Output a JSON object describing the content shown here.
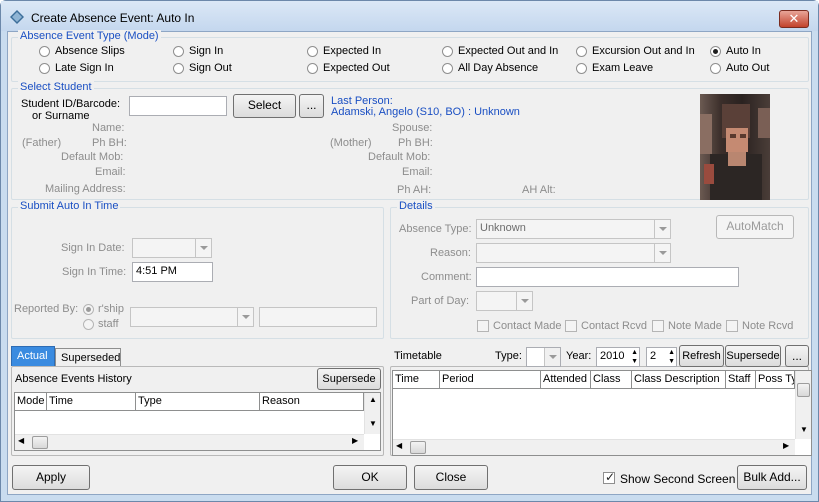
{
  "window": {
    "title": "Create Absence Event: Auto In"
  },
  "event_type": {
    "title": "Absence Event Type (Mode)",
    "options": [
      {
        "label": "Absence Slips",
        "checked": false
      },
      {
        "label": "Sign In",
        "checked": false
      },
      {
        "label": "Expected In",
        "checked": false
      },
      {
        "label": "Expected Out and In",
        "checked": false
      },
      {
        "label": "Excursion Out and In",
        "checked": false
      },
      {
        "label": "Auto In",
        "checked": true
      },
      {
        "label": "Late Sign In",
        "checked": false
      },
      {
        "label": "Sign Out",
        "checked": false
      },
      {
        "label": "Expected Out",
        "checked": false
      },
      {
        "label": "All Day Absence",
        "checked": false
      },
      {
        "label": "Exam Leave",
        "checked": false
      },
      {
        "label": "Auto Out",
        "checked": false
      }
    ]
  },
  "student": {
    "title": "Select Student",
    "id_label_1": "Student ID/Barcode:",
    "id_label_2": "or Surname",
    "id_value": "",
    "select_button": "Select",
    "more_button": "...",
    "last_person_label": "Last Person:",
    "last_person_value": "Adamski, Angelo (S10, BO) : Unknown",
    "name_label": "Name:",
    "father_label": "(Father)",
    "ph_bh_label": "Ph BH:",
    "default_mob_label": "Default Mob:",
    "email_label": "Email:",
    "mailing_label": "Mailing Address:",
    "spouse_label": "Spouse:",
    "mother_label": "(Mother)",
    "ph_bh2_label": "Ph BH:",
    "default_mob2_label": "Default Mob:",
    "email2_label": "Email:",
    "ph_ah_label": "Ph AH:",
    "ah_alt_label": "AH Alt:"
  },
  "auto_in": {
    "title": "Submit Auto In Time",
    "sign_in_date_label": "Sign In Date:",
    "sign_in_date_value": "",
    "sign_in_time_label": "Sign In Time:",
    "sign_in_time_value": "4:51 PM",
    "reported_by_label": "Reported By:",
    "parent_option": "r'ship",
    "staff_option": "staff",
    "reported_combo_value": "",
    "reported_text_value": ""
  },
  "details": {
    "title": "Details",
    "absence_type_label": "Absence Type:",
    "absence_type_value": "Unknown",
    "automatch_button": "AutoMatch",
    "reason_label": "Reason:",
    "reason_value": "",
    "comment_label": "Comment:",
    "comment_value": "",
    "part_of_day_label": "Part of Day:",
    "part_of_day_value": "",
    "checks": [
      "Contact Made",
      "Contact Rcvd",
      "Note Made",
      "Note Rcvd"
    ]
  },
  "history": {
    "tabs": [
      "Actual",
      "Superseded"
    ],
    "active_tab": "Actual",
    "title": "Absence Events History",
    "supersede_button": "Supersede",
    "columns": [
      "Mode",
      "Time",
      "Type",
      "Reason"
    ]
  },
  "timetable": {
    "title": "Timetable",
    "type_label": "Type:",
    "type_value": "",
    "year_label": "Year:",
    "year_value": "2010",
    "term_value": "2",
    "refresh_button": "Refresh",
    "supersede_button": "Supersede",
    "more_button": "...",
    "columns": [
      "Time",
      "Period",
      "Attended",
      "Class",
      "Class Description",
      "Staff",
      "Poss Ty"
    ]
  },
  "footer": {
    "apply_button": "Apply",
    "ok_button": "OK",
    "close_button": "Close",
    "show_second_screen_label": "Show Second Screen",
    "show_second_screen_checked": true,
    "bulk_add_button": "Bulk Add..."
  }
}
